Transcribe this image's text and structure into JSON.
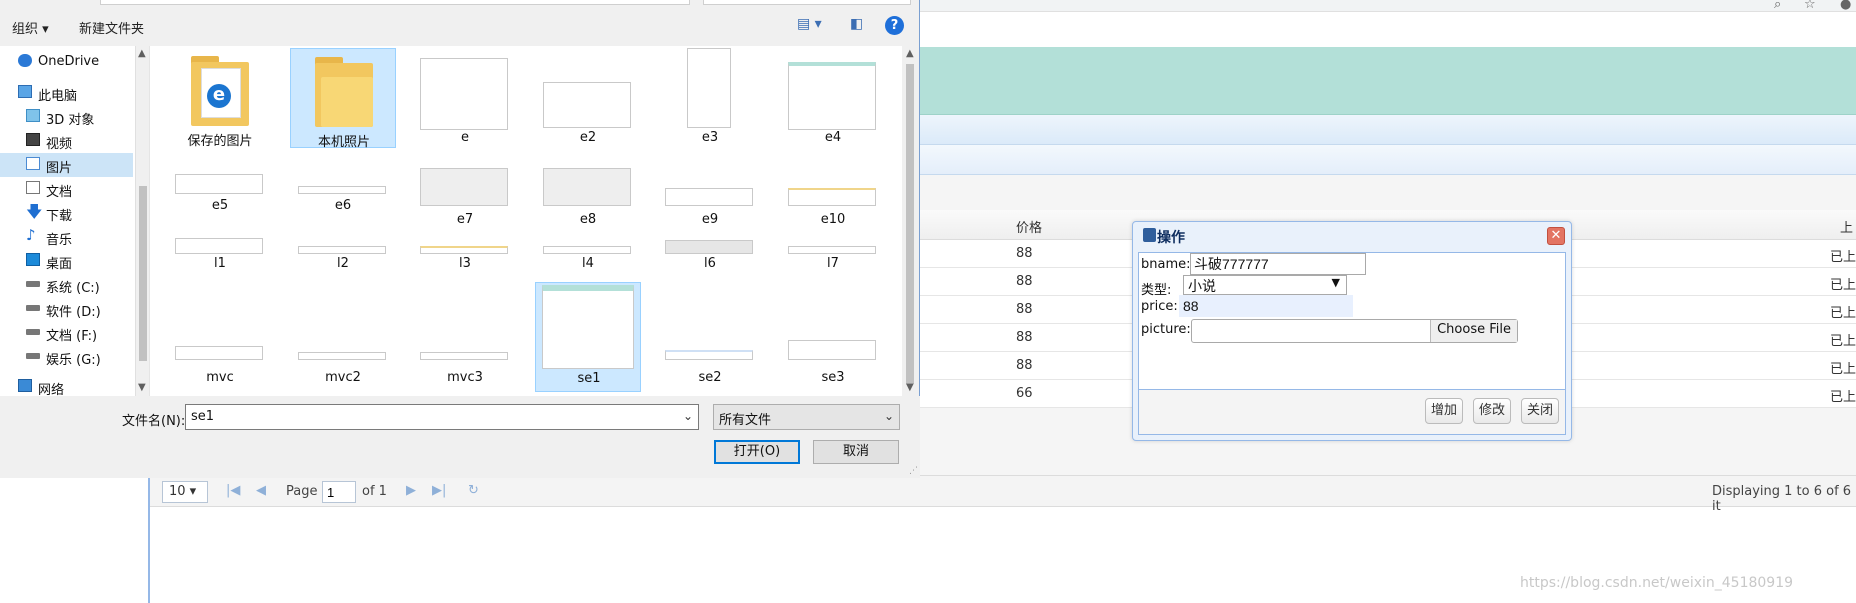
{
  "file_dialog": {
    "toolbar": {
      "organize": "组织 ▾",
      "new_folder": "新建文件夹"
    },
    "nav": [
      {
        "label": "OneDrive",
        "icon": "cloud-icon"
      },
      {
        "label": "此电脑",
        "icon": "computer-icon"
      },
      {
        "label": "3D 对象",
        "icon": "cube-icon"
      },
      {
        "label": "视频",
        "icon": "video-icon"
      },
      {
        "label": "图片",
        "icon": "pictures-icon",
        "selected": true
      },
      {
        "label": "文档",
        "icon": "document-icon"
      },
      {
        "label": "下载",
        "icon": "download-icon"
      },
      {
        "label": "音乐",
        "icon": "music-icon"
      },
      {
        "label": "桌面",
        "icon": "desktop-icon"
      },
      {
        "label": "系统 (C:)",
        "icon": "drive-icon"
      },
      {
        "label": "软件 (D:)",
        "icon": "drive-icon"
      },
      {
        "label": "文档 (F:)",
        "icon": "drive-icon"
      },
      {
        "label": "娱乐 (G:)",
        "icon": "drive-icon"
      },
      {
        "label": "网络",
        "icon": "network-icon"
      }
    ],
    "files": [
      {
        "name": "保存的图片"
      },
      {
        "name": "本机照片"
      },
      {
        "name": "e"
      },
      {
        "name": "e2"
      },
      {
        "name": "e3"
      },
      {
        "name": "e4"
      },
      {
        "name": "e5"
      },
      {
        "name": "e6"
      },
      {
        "name": "e7"
      },
      {
        "name": "e8"
      },
      {
        "name": "e9"
      },
      {
        "name": "e10"
      },
      {
        "name": "l1"
      },
      {
        "name": "l2"
      },
      {
        "name": "l3"
      },
      {
        "name": "l4"
      },
      {
        "name": "l6"
      },
      {
        "name": "l7"
      },
      {
        "name": "mvc"
      },
      {
        "name": "mvc2"
      },
      {
        "name": "mvc3"
      },
      {
        "name": "se1"
      },
      {
        "name": "se2"
      },
      {
        "name": "se3"
      }
    ],
    "filename_label": "文件名(N):",
    "filename_value": "se1",
    "filetype_value": "所有文件",
    "open_label": "打开(O)",
    "cancel_label": "取消"
  },
  "grid": {
    "price_header": "价格",
    "status_header": "上",
    "rows": [
      {
        "price": "88",
        "status": "已上"
      },
      {
        "price": "88",
        "status": "已上"
      },
      {
        "price": "88",
        "status": "已上"
      },
      {
        "price": "88",
        "status": "已上"
      },
      {
        "price": "88",
        "status": "已上"
      },
      {
        "price": "66",
        "status": "已上"
      }
    ],
    "pager": {
      "page_size": "10",
      "page_label": "Page",
      "page_value": "1",
      "of_label": "of 1",
      "display_text": "Displaying 1 to 6 of 6 it"
    }
  },
  "op_dialog": {
    "title": "操作",
    "fields": {
      "bname_label": "bname:",
      "bname_value": "斗破777777",
      "type_label": "类型:",
      "type_value": "小说",
      "price_label": "price:",
      "price_value": "88",
      "picture_label": "picture:",
      "choose_file": "Choose File"
    },
    "buttons": {
      "add": "增加",
      "edit": "修改",
      "close": "关闭"
    }
  },
  "watermark": "https://blog.csdn.net/weixin_45180919"
}
